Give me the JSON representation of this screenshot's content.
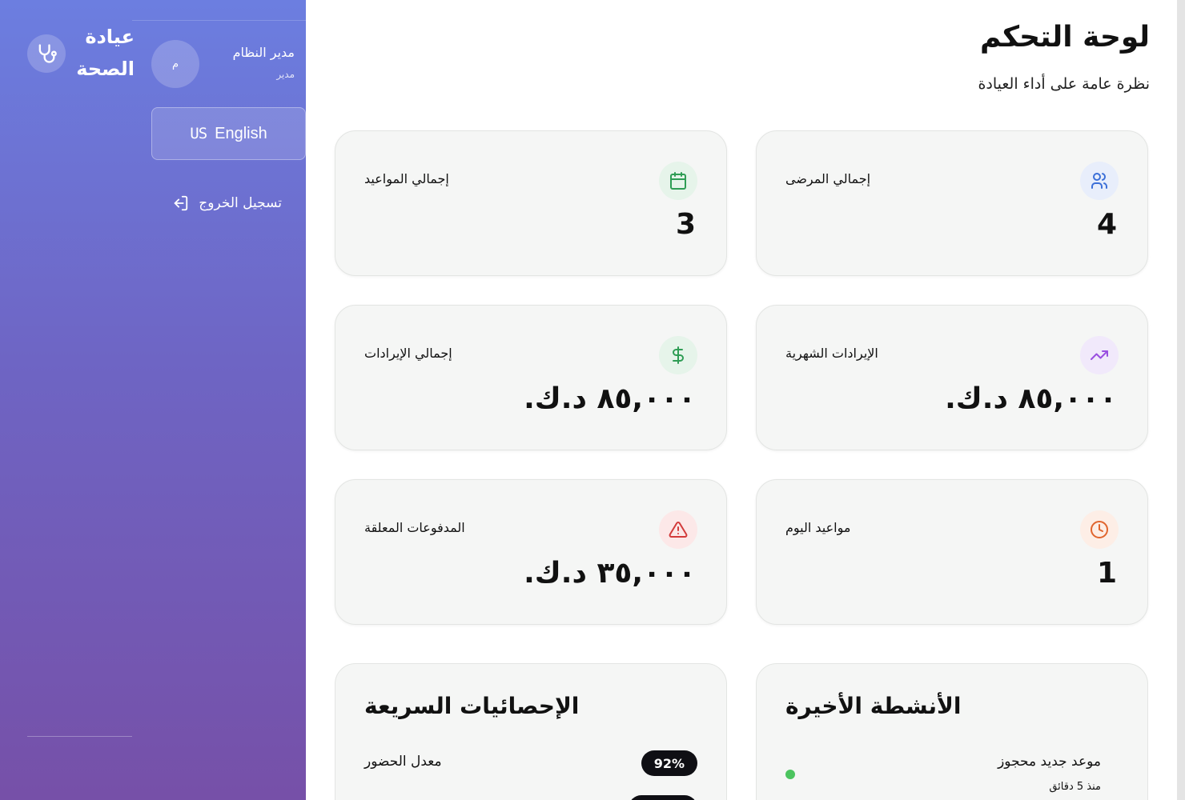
{
  "sidebar": {
    "brand_line1": "عيادة",
    "brand_line2": "الصحة",
    "brand_icon": "stethoscope-icon",
    "user": {
      "initial": "م",
      "name": "مدير النظام",
      "role": "مدير"
    },
    "language_button": {
      "flag": "US",
      "label": "English"
    },
    "logout_label": "تسجيل الخروج"
  },
  "header": {
    "title": "لوحة التحكم",
    "subtitle": "نظرة عامة على أداء العيادة"
  },
  "stats": {
    "patients": {
      "label": "إجمالي المرضى",
      "value": "4",
      "icon": "users-icon",
      "icon_color": "#3b6fd8",
      "icon_bg": "#e8eefb"
    },
    "appointments": {
      "label": "إجمالي المواعيد",
      "value": "3",
      "icon": "calendar-icon",
      "icon_color": "#2f9d55",
      "icon_bg": "#e6f4ea"
    },
    "monthly_revenue": {
      "label": "الإيرادات الشهرية",
      "value": "٨٥,٠٠٠ د.ك.",
      "icon": "trending-up-icon",
      "icon_color": "#9a4fe0",
      "icon_bg": "#f1e9fb"
    },
    "total_revenue": {
      "label": "إجمالي الإيرادات",
      "value": "٨٥,٠٠٠ د.ك.",
      "icon": "dollar-icon",
      "icon_color": "#2f9d55",
      "icon_bg": "#e6f4ea"
    },
    "today_appointments": {
      "label": "مواعيد اليوم",
      "value": "1",
      "icon": "clock-icon",
      "icon_color": "#e0652e",
      "icon_bg": "#fdeee6"
    },
    "pending_payments": {
      "label": "المدفوعات المعلقة",
      "value": "٣٥,٠٠٠ د.ك.",
      "icon": "alert-triangle-icon",
      "icon_color": "#d33b3b",
      "icon_bg": "#fce8e8"
    }
  },
  "recent_activity": {
    "title": "الأنشطة الأخيرة",
    "items": [
      {
        "title": "موعد جديد محجوز",
        "time": "منذ 5 دقائق",
        "status_color": "#4cc45f"
      }
    ]
  },
  "quick_stats": {
    "title": "الإحصائيات السريعة",
    "items": [
      {
        "label": "معدل الحضور",
        "value": "92%"
      }
    ]
  }
}
